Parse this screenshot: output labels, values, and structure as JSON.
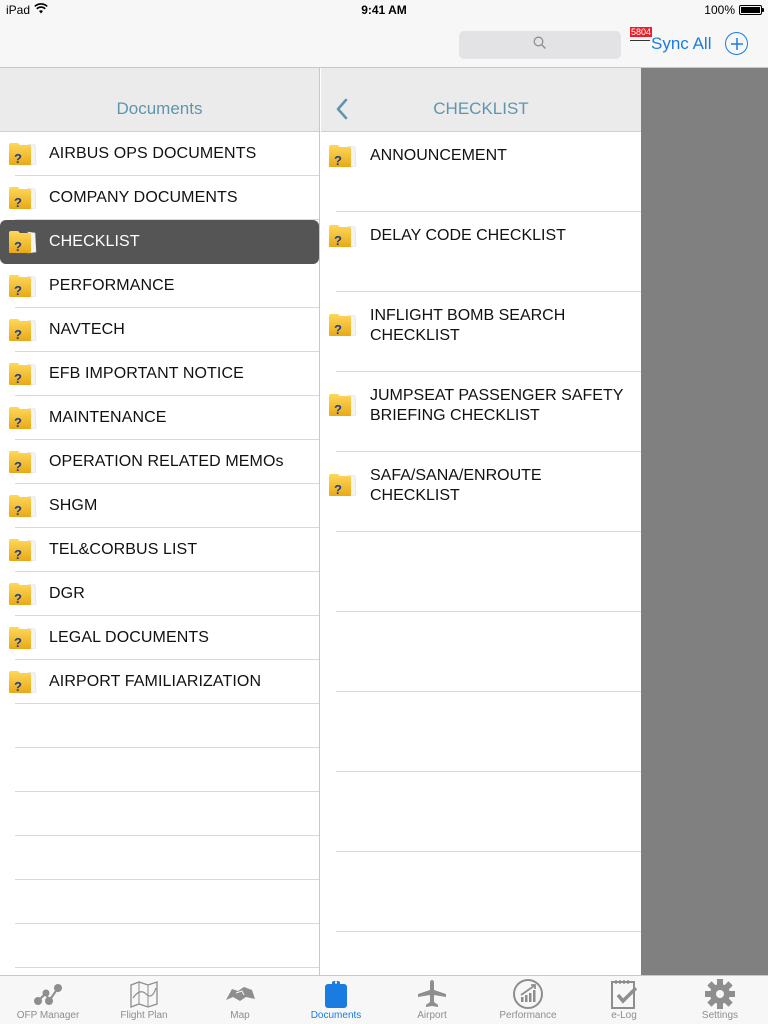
{
  "status_bar": {
    "device": "iPad",
    "time": "9:41 AM",
    "battery_percent": "100%",
    "battery_level": 1.0
  },
  "toolbar": {
    "search_placeholder": "",
    "badge_count": "5804",
    "sync_all_label": "Sync All",
    "add_icon": "plus-circle-icon"
  },
  "colors": {
    "accent": "#1a7ce0",
    "header_title": "#5f95ad",
    "selected_row": "#555555",
    "badge": "#e8202a",
    "detail_placeholder": "#808080"
  },
  "left_pane": {
    "title": "Documents",
    "selected_index": 2,
    "items": [
      {
        "label": "AIRBUS OPS DOCUMENTS",
        "icon": "folder-question-icon"
      },
      {
        "label": "COMPANY DOCUMENTS",
        "icon": "folder-question-icon"
      },
      {
        "label": "CHECKLIST",
        "icon": "folder-question-icon"
      },
      {
        "label": "PERFORMANCE",
        "icon": "folder-question-icon"
      },
      {
        "label": "NAVTECH",
        "icon": "folder-question-icon"
      },
      {
        "label": "EFB IMPORTANT NOTICE",
        "icon": "folder-question-icon"
      },
      {
        "label": "MAINTENANCE",
        "icon": "folder-question-icon"
      },
      {
        "label": "OPERATION RELATED MEMOs",
        "icon": "folder-question-icon"
      },
      {
        "label": "SHGM",
        "icon": "folder-question-icon"
      },
      {
        "label": "TEL&CORBUS LIST",
        "icon": "folder-question-icon"
      },
      {
        "label": "DGR",
        "icon": "folder-question-icon"
      },
      {
        "label": "LEGAL DOCUMENTS",
        "icon": "folder-question-icon"
      },
      {
        "label": "AIRPORT FAMILIARIZATION",
        "icon": "folder-question-icon"
      }
    ]
  },
  "middle_pane": {
    "title": "CHECKLIST",
    "back_icon": "chevron-left-icon",
    "items": [
      {
        "label": "ANNOUNCEMENT",
        "icon": "folder-question-icon"
      },
      {
        "label": "DELAY CODE CHECKLIST",
        "icon": "folder-question-icon"
      },
      {
        "label": "INFLIGHT BOMB SEARCH CHECKLIST",
        "icon": "folder-question-icon"
      },
      {
        "label": "JUMPSEAT PASSENGER SAFETY BRIEFING CHECKLIST",
        "icon": "folder-question-icon"
      },
      {
        "label": "SAFA/SANA/ENROUTE CHECKLIST",
        "icon": "folder-question-icon"
      }
    ]
  },
  "tabbar": {
    "active_index": 3,
    "tabs": [
      {
        "label": "OFP Manager",
        "icon": "ofp-manager-icon"
      },
      {
        "label": "Flight Plan",
        "icon": "flight-plan-map-icon"
      },
      {
        "label": "Map",
        "icon": "map-icon"
      },
      {
        "label": "Documents",
        "icon": "documents-clipboard-icon"
      },
      {
        "label": "Airport",
        "icon": "airplane-icon"
      },
      {
        "label": "Performance",
        "icon": "performance-chart-icon"
      },
      {
        "label": "e-Log",
        "icon": "elog-checklist-icon"
      },
      {
        "label": "Settings",
        "icon": "gear-icon"
      }
    ]
  }
}
